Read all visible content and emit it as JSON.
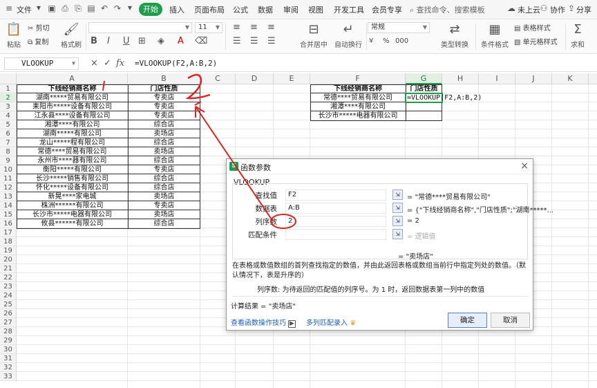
{
  "menu": {
    "file": "文件",
    "tabs": [
      "开始",
      "插入",
      "页面布局",
      "公式",
      "数据",
      "审阅",
      "视图",
      "开发工具",
      "会员专享"
    ],
    "search_placeholder": "查找命令、搜索模板",
    "cloud": "未上云",
    "collab": "协作",
    "share": "分享"
  },
  "ribbon": {
    "paste": "粘贴",
    "cut": "剪切",
    "copy": "复制",
    "format_painter": "格式刷",
    "font_size": "11",
    "bold": "B",
    "italic": "I",
    "underline": "U",
    "merge_center": "合并居中",
    "wrap": "自动换行",
    "number_format": "常规",
    "type_convert": "类型转换",
    "conditional_format": "条件格式",
    "table_style": "表格样式",
    "cell_style": "单元格样式",
    "sum": "求和",
    "percent": "%",
    "thousands": "000"
  },
  "formula_bar": {
    "name_box": "VLOOKUP",
    "cancel": "×",
    "confirm": "✓",
    "fx": "fx",
    "formula": "=VLOOKUP(F2,A:B,2)"
  },
  "sheet": {
    "columns": [
      "A",
      "B",
      "C",
      "D",
      "E",
      "F",
      "G",
      "H",
      "I",
      "J",
      "K"
    ],
    "active_column": "G",
    "active_row": 2,
    "rows": [
      "1",
      "2",
      "3",
      "4",
      "5",
      "6",
      "7",
      "8",
      "9",
      "10",
      "11",
      "12",
      "13",
      "14",
      "15",
      "16",
      "17",
      "18",
      "19",
      "20",
      "21",
      "22",
      "23",
      "24",
      "25",
      "26",
      "27",
      "28",
      "29",
      "30",
      "31",
      "32",
      "33"
    ],
    "header_a": "下线经销商名称",
    "header_b": "门店性质",
    "table_ab": [
      [
        "湖南*****贸易有限公司",
        "专卖店"
      ],
      [
        "耒阳市*****设备有限公司",
        "专卖店"
      ],
      [
        "江永县****设备有限公司",
        "专卖店"
      ],
      [
        "湘潭****有限公司",
        "综合店"
      ],
      [
        "湖南*****有限公司",
        "卖场店"
      ],
      [
        "龙山*****程有限公司",
        "综合店"
      ],
      [
        "常德****贸易有限公司",
        "卖场店"
      ],
      [
        "永州市****器有限公司",
        "综合店"
      ],
      [
        "衡阳*****有限公司",
        "专卖店"
      ],
      [
        "长沙*****销售有限公司",
        "综合店"
      ],
      [
        "怀化*****设备有限公司",
        "综合店"
      ],
      [
        "新晃****家电城",
        "卖场店"
      ],
      [
        "株洲******有限公司",
        "专卖店"
      ],
      [
        "长沙市*****电器有限公司",
        "卖场店"
      ],
      [
        "攸县******有限公司",
        "综合店"
      ]
    ],
    "header_f": "下线经销商名称",
    "header_g": "门店性质",
    "lookup_f": [
      "常德****贸易有限公司",
      "湘潭****有限公司",
      "长沙市*****电器有限公司"
    ],
    "g2_formula": "=VLOOKUP(F2,A:B,2)"
  },
  "dialog": {
    "title": "函数参数",
    "close": "×",
    "function_name": "VLOOKUP",
    "args": [
      {
        "label": "查找值",
        "value": "F2",
        "result": "= \"常德****贸易有限公司\"",
        "muted": false
      },
      {
        "label": "数据表",
        "value": "A:B",
        "result": "= {\"下线经销商名称\",\"门店性质\";\"湖南*****...",
        "muted": false
      },
      {
        "label": "列序数",
        "value": "2",
        "result": "= 2",
        "muted": false
      },
      {
        "label": "匹配条件",
        "value": "",
        "result": "= 逻辑值",
        "muted": true
      }
    ],
    "function_result": "= \"卖场店\"",
    "description": "在表格或数值数组的首列查找指定的数值，并由此返回表格或数组当前行中指定列处的数值。（默认情况下，表是升序的）",
    "arg_description": "列序数:   为待返回的匹配值的列序号。为 1 时，返回数据表第一列中的数值",
    "calc_result": "计算结果 = \"卖场店\"",
    "link_tips": "查看函数操作技巧",
    "link_multi": "多列匹配录入",
    "ok": "确定",
    "cancel": "取消"
  },
  "annotations": {
    "number_one": "1",
    "number_two": "2",
    "color": "#e02020"
  },
  "colors": {
    "accent": "#1e9e4a",
    "link": "#1b5fbf",
    "annotation": "#e02020"
  }
}
